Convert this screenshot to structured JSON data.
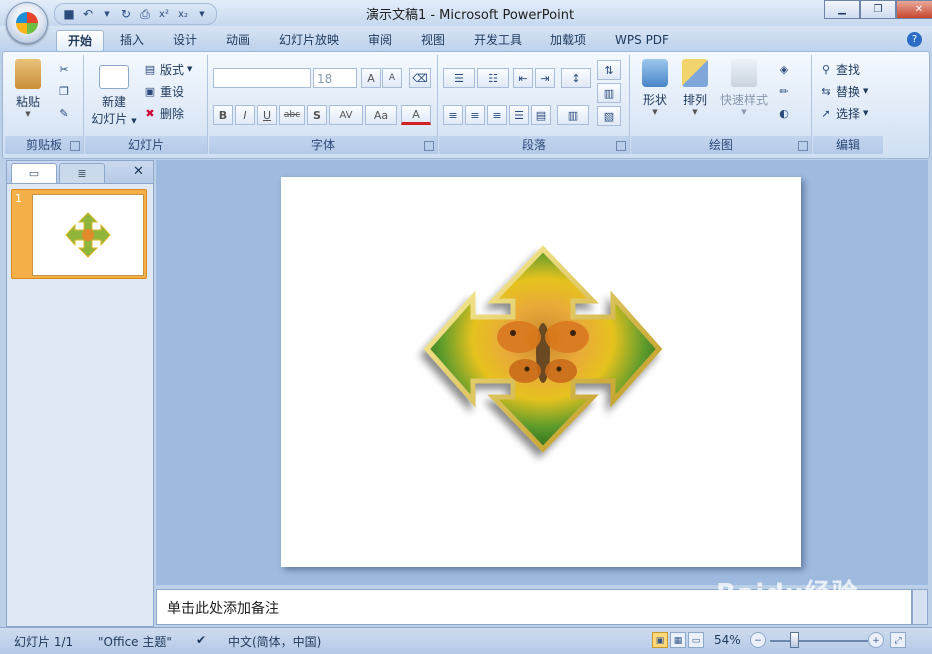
{
  "window": {
    "title": "演示文稿1 - Microsoft PowerPoint",
    "quick_access": [
      "save-icon",
      "undo-icon",
      "redo-icon",
      "print-preview-icon",
      "subscript-icon",
      "superscript-icon",
      "customize-icon"
    ]
  },
  "tabs": [
    "开始",
    "插入",
    "设计",
    "动画",
    "幻灯片放映",
    "审阅",
    "视图",
    "开发工具",
    "加载项",
    "WPS PDF"
  ],
  "active_tab": "开始",
  "ribbon": {
    "clipboard": {
      "paste": "粘贴",
      "label": "剪贴板"
    },
    "slides": {
      "new_slide_line1": "新建",
      "new_slide_line2": "幻灯片",
      "layout": "版式",
      "reset": "重设",
      "delete": "删除",
      "label": "幻灯片"
    },
    "font": {
      "font_name": "",
      "font_size": "18",
      "bold": "B",
      "italic": "I",
      "underline": "U",
      "strike": "abc",
      "shadow": "S",
      "spacing": "AV",
      "case": "Aa",
      "color": "A",
      "grow": "A",
      "shrink": "A",
      "label": "字体"
    },
    "paragraph": {
      "label": "段落"
    },
    "drawing": {
      "shapes": "形状",
      "arrange": "排列",
      "quick_styles": "快速样式",
      "label": "绘图"
    },
    "editing": {
      "find": "查找",
      "replace": "替换",
      "select": "选择",
      "label": "编辑"
    }
  },
  "slides_panel": {
    "slide_number": "1"
  },
  "notes": {
    "placeholder": "单击此处添加备注"
  },
  "status": {
    "slide_info": "幻灯片 1/1",
    "theme": "\"Office 主题\"",
    "language": "中文(简体，中国)",
    "zoom": "54%",
    "zoom_fraction": 0.54
  },
  "watermark": "Baidu经验",
  "colors": {
    "accent": "#f6b04a",
    "ribbon": "#dbe7f6",
    "workspace": "#9fbadf"
  }
}
